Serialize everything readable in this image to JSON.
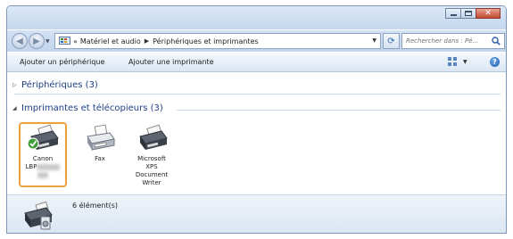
{
  "window": {
    "controls": {
      "minimize": "minimize-icon",
      "maximize": "maximize-icon",
      "close": "close-icon"
    }
  },
  "nav": {
    "back_icon": "back-arrow-icon",
    "forward_icon": "forward-arrow-icon",
    "address": {
      "overflow": "«",
      "segments": [
        "Matériel et audio",
        "Périphériques et imprimantes"
      ]
    },
    "refresh_icon": "refresh-icon",
    "search_placeholder": "Rechercher dans : Pé..."
  },
  "toolbar": {
    "add_device": "Ajouter un périphérique",
    "add_printer": "Ajouter une imprimante",
    "view_icon": "view-options-icon",
    "help_icon": "help-icon"
  },
  "groups": [
    {
      "label": "Périphériques (3)",
      "collapsed": true
    },
    {
      "label": "Imprimantes et télécopieurs (3)",
      "collapsed": false
    }
  ],
  "devices": [
    {
      "line1": "Canon",
      "line2": "LBP",
      "redacted": true,
      "default": true,
      "selected": true
    },
    {
      "line1": "Fax"
    },
    {
      "lines": [
        "Microsoft",
        "XPS",
        "Document",
        "Writer"
      ]
    }
  ],
  "details": {
    "count": "6 élément(s)"
  },
  "colors": {
    "selection": "#e9a33a",
    "group_header": "#1e3f87",
    "title_gradient": "#c4d7ee"
  }
}
